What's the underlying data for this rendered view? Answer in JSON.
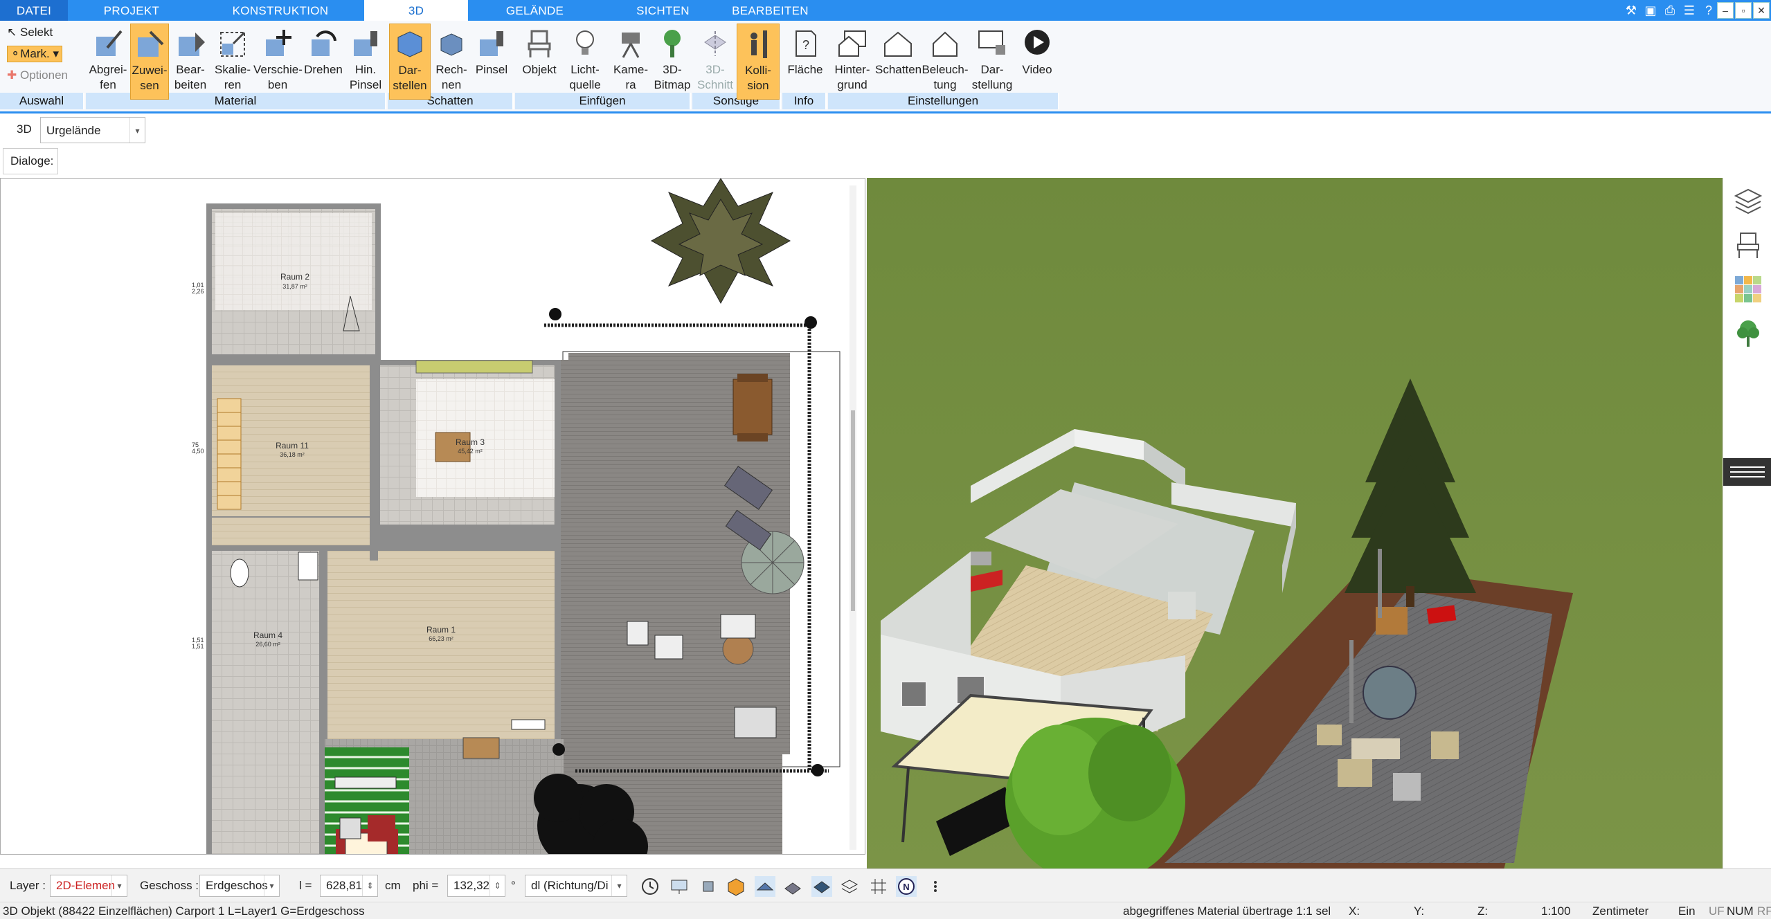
{
  "tabs": [
    "DATEI",
    "PROJEKT",
    "KONSTRUKTION",
    "3D",
    "GELÄNDE",
    "SICHTEN",
    "BEARBEITEN"
  ],
  "auswahl": {
    "selekt": "Selekt",
    "mark": "Mark.",
    "optionen": "Optionen",
    "group": "Auswahl"
  },
  "ribbon": {
    "material": {
      "group": "Material",
      "buttons": [
        "Abgrei-\nfen",
        "Zuwei-\nsen",
        "Bear-\nbeiten",
        "Skalie-\nren",
        "Verschie-\nben",
        "Drehen",
        "Hin.\nPinsel"
      ]
    },
    "schatten": {
      "group": "Schatten",
      "buttons": [
        "Dar-\nstellen",
        "Rech-\nnen",
        "Pinsel"
      ]
    },
    "einfuegen": {
      "group": "Einfügen",
      "buttons": [
        "Objekt",
        "Licht-\nquelle",
        "Kame-\nra",
        "3D-\nBitmap"
      ]
    },
    "sonstige": {
      "group": "Sonstige",
      "buttons": [
        "3D-\nSchnitt",
        "Kolli-\nsion"
      ]
    },
    "info": {
      "group": "Info",
      "buttons": [
        "Fläche"
      ]
    },
    "einstellungen": {
      "group": "Einstellungen",
      "buttons": [
        "Hinter-\ngrund",
        "Schatten",
        "Beleuch-\ntung",
        "Dar-\nstellung",
        "Video"
      ]
    }
  },
  "bar2": {
    "label": "3D",
    "combo": "Urgelände"
  },
  "bar3": {
    "label": "Dialoge:"
  },
  "plan": {
    "rooms": [
      {
        "name": "Raum 2",
        "area": "31,87 m²"
      },
      {
        "name": "Raum 11",
        "area": "36,18 m²"
      },
      {
        "name": "Raum 3",
        "area": "45,42 m²"
      },
      {
        "name": "Raum 1",
        "area": "66,23 m²"
      },
      {
        "name": "Raum 4",
        "area": "26,60 m²"
      }
    ],
    "dims": [
      "1,01",
      "2,26",
      "75",
      "4,50",
      "1,51",
      "1,51"
    ]
  },
  "bottom": {
    "layer_label": "Layer :",
    "layer_value": "2D-Elemen",
    "geschoss_label": "Geschoss :",
    "geschoss_value": "Erdgeschos",
    "l_label": "l =",
    "l_value": "628,81",
    "l_unit": "cm",
    "phi_label": "phi =",
    "phi_value": "132,32",
    "phi_unit": "°",
    "dl_value": "dl (Richtung/Di"
  },
  "status": {
    "left": "3D Objekt (88422 Einzelflächen) Carport 1 L=Layer1 G=Erdgeschoss",
    "msg": "abgegriffenes Material übertrage 1:1 sel",
    "x": "X:",
    "y": "Y:",
    "z": "Z:",
    "scale": "1:100",
    "unit": "Zentimeter",
    "ein": "Ein",
    "uf": "UF",
    "num": "NUM",
    "rf": "RF"
  },
  "colors": {
    "accent": "#2a8ef0",
    "selected": "#fdc25a",
    "group_bg": "#cfe5fb",
    "grass": "#6f8a3c"
  }
}
